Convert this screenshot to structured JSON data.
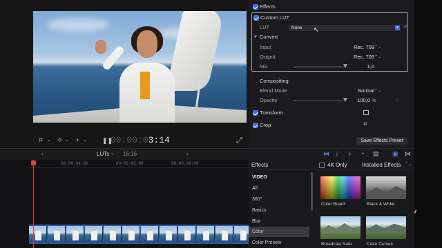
{
  "viewer": {
    "timecode_dim": "00:00:0",
    "timecode_main": "3:14"
  },
  "inspector": {
    "effects_label": "Effects",
    "custom_lut_label": "Custom LUT",
    "lut_label": "LUT",
    "lut_value": "None",
    "convert_label": "Convert",
    "input_label": "Input",
    "input_value": "Rec. 709",
    "output_label": "Output",
    "output_value": "Rec. 709",
    "mix_label": "Mix",
    "mix_value": "1,0",
    "mix_level": 1.0,
    "compositing_label": "Compositing",
    "blend_mode_label": "Blend Mode",
    "blend_mode_value": "Normal",
    "opacity_label": "Opacity",
    "opacity_value": "100,0",
    "opacity_unit": "%",
    "opacity_level": 1.0,
    "transform_label": "Transform",
    "crop_label": "Crop",
    "save_preset_label": "Save Effects Preset"
  },
  "timeline_toolbar": {
    "project_name": "LUTs",
    "duration": "16:16"
  },
  "timeline": {
    "ruler_labels": [
      "00:00:04:00",
      "00:00:05:00",
      "00:00:06:00"
    ]
  },
  "effects_browser": {
    "title": "Effects",
    "filter_4k_label": "4K Only",
    "installed_label": "Installed Effects",
    "categories": [
      "VIDEO",
      "All",
      "360°",
      "Basics",
      "Blur",
      "Color",
      "Color Presets"
    ],
    "selected_category": "Color",
    "tiles": [
      {
        "label": "Color Board"
      },
      {
        "label": "Black & White"
      },
      {
        "label": "Broadcast Safe"
      },
      {
        "label": "Color Curves"
      }
    ]
  },
  "colors": {
    "accent": "#3b6fe0",
    "playhead": "#e0413a"
  }
}
